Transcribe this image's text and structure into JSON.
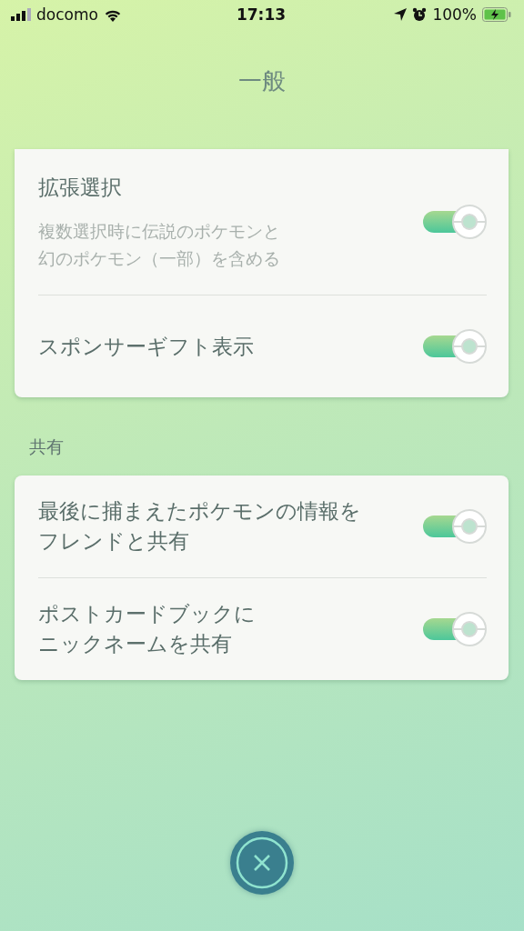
{
  "status_bar": {
    "carrier": "docomo",
    "time": "17:13",
    "battery": "100%"
  },
  "title": "一般",
  "sections": [
    {
      "items": [
        {
          "label": "拡張選択",
          "description": "複数選択時に伝説のポケモンと幻のポケモン（一部）を含める",
          "on": true
        },
        {
          "label": "スポンサーギフト表示",
          "on": true
        }
      ]
    },
    {
      "heading": "共有",
      "items": [
        {
          "label": "最後に捕まえたポケモンの情報をフレンドと共有",
          "on": true
        },
        {
          "label": "ポストカードブックにニックネームを共有",
          "on": true
        }
      ]
    }
  ]
}
